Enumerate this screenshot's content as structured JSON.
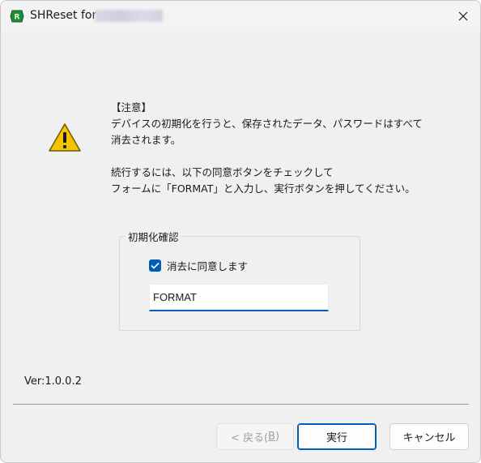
{
  "window": {
    "title": "SHReset for",
    "app_icon": "shreset-logo-icon",
    "close_icon": "close-icon"
  },
  "message": {
    "heading": "【注意】",
    "line1": "デバイスの初期化を行うと、保存されたデータ、パスワードはすべて",
    "line2": "消去されます。",
    "line3": "続行するには、以下の同意ボタンをチェックして",
    "line4": "フォームに「FORMAT」と入力し、実行ボタンを押してください。",
    "icon": "warning-icon"
  },
  "confirm_group": {
    "label": "初期化確認",
    "checkbox_label": "消去に同意します",
    "checkbox_checked": true,
    "input_value": "FORMAT"
  },
  "version": "Ver:1.0.0.2",
  "buttons": {
    "back_prefix": "< 戻る(",
    "back_accel": "B",
    "back_suffix": ")",
    "back_enabled": false,
    "run": "実行",
    "cancel": "キャンセル"
  },
  "colors": {
    "accent": "#005fb8",
    "warning_yellow": "#f5c400"
  }
}
